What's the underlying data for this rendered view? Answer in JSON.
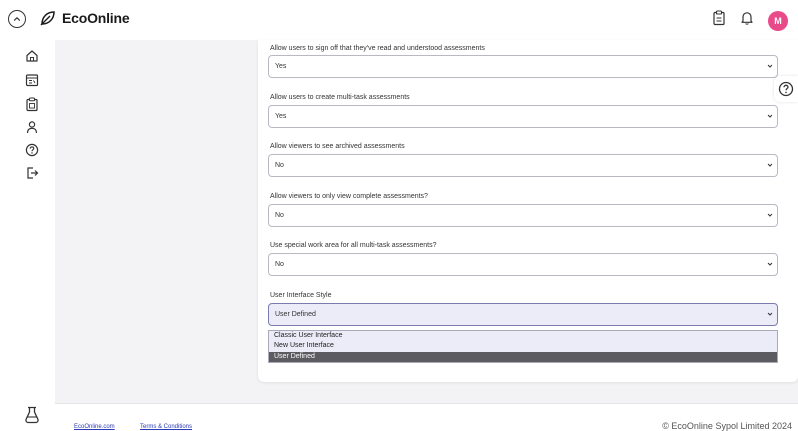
{
  "header": {
    "brand": "EcoOnline",
    "avatar_initial": "M",
    "avatar_color": "#e94b8a",
    "icons": [
      "collapse-icon",
      "ecoonline-logo-icon",
      "clipboard-icon",
      "bell-icon"
    ]
  },
  "sidebar": {
    "icons": [
      "home-icon",
      "calendar-icon",
      "clipboard-list-icon",
      "user-icon",
      "help-icon",
      "logout-icon",
      "flask-icon"
    ]
  },
  "settings": [
    {
      "label": "Allow users to sign off that they've read and understood assessments",
      "value": "Yes"
    },
    {
      "label": "Allow users to create multi-task assessments",
      "value": "Yes"
    },
    {
      "label": "Allow viewers to see archived assessments",
      "value": "No"
    },
    {
      "label": "Allow viewers to only view complete assessments?",
      "value": "No"
    },
    {
      "label": "Use special work area for all multi-task assessments?",
      "value": "No"
    },
    {
      "label": "User Interface Style",
      "value": "User Defined"
    }
  ],
  "dropdown_options": [
    "Classic User Interface",
    "New User Interface",
    "User Defined"
  ],
  "dropdown_selected": "User Defined",
  "footer": {
    "link1": "EcoOnline.com",
    "link2": "Terms & Conditions",
    "copyright": "© EcoOnline Sypol Limited 2024"
  }
}
